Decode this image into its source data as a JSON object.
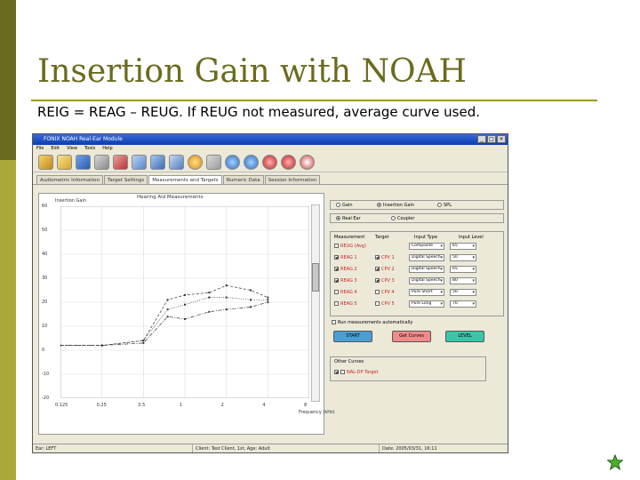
{
  "slide": {
    "title": "Insertion Gain with NOAH",
    "subtitle": "REIG = REAG – REUG. If REUG not measured, average curve used.",
    "accent": "#6b6b1e",
    "accent_light": "#a9a93a"
  },
  "app": {
    "window_title": "FONIX NOAH Real-Ear Module",
    "menu": [
      "File",
      "Edit",
      "View",
      "Tools",
      "Help"
    ],
    "toolbar_icons": [
      "new-icon",
      "open-icon",
      "save-icon",
      "print-icon",
      "settings-icon",
      "graph-icon",
      "measure-icon",
      "curve-icon",
      "target-icon",
      "list-icon",
      "noah-icon",
      "ssl-icon",
      "reference-icon",
      "help-icon"
    ],
    "tabs": [
      "Audiometric Information",
      "Target Settings",
      "Measurements and Targets",
      "Numeric Data",
      "Session Information"
    ],
    "active_tab": "Measurements and Targets",
    "graph": {
      "title": "Hearing Aid Measurements",
      "y_title": "Insertion Gain",
      "x_title": "Frequency (kHz)",
      "y_ticks": [
        "60",
        "50",
        "40",
        "30",
        "20",
        "10",
        "0",
        "-10",
        "-20"
      ],
      "x_ticks": [
        "0.125",
        "0.25",
        "0.5",
        "1",
        "2",
        "4",
        "8"
      ]
    },
    "display_mode": {
      "options": [
        "Gain",
        "Insertion Gain",
        "SPL"
      ],
      "selected": "Insertion Gain"
    },
    "ear_mode": {
      "options": [
        "Real Ear",
        "Coupler"
      ],
      "selected": "Real Ear"
    },
    "meas_headers": [
      "Measurement",
      "Target",
      "Input Type",
      "Input Level"
    ],
    "measurements": [
      {
        "meas": "REUG (Avg)",
        "meas_checked": false,
        "target": "",
        "target_checked": false,
        "input_type": "Composite",
        "input_level": "65",
        "color": "#cc2222"
      },
      {
        "meas": "REAG 1",
        "meas_checked": true,
        "target": "CPV 1",
        "target_checked": true,
        "input_type": "Digital Speech",
        "input_level": "50",
        "color": "#cc2222"
      },
      {
        "meas": "REAG 2",
        "meas_checked": true,
        "target": "CPV 2",
        "target_checked": true,
        "input_type": "Digital Speech",
        "input_level": "65",
        "color": "#cc2222"
      },
      {
        "meas": "REAG 3",
        "meas_checked": true,
        "target": "CPV 3",
        "target_checked": true,
        "input_type": "Digital Speech",
        "input_level": "80",
        "color": "#cc2222"
      },
      {
        "meas": "REAG 4",
        "meas_checked": false,
        "target": "CPV 4",
        "target_checked": false,
        "input_type": "Pure Short",
        "input_level": "50",
        "color": "#cc2222"
      },
      {
        "meas": "REAG 5",
        "meas_checked": false,
        "target": "CPV 5",
        "target_checked": false,
        "input_type": "Pure Long",
        "input_level": "70",
        "color": "#cc2222"
      }
    ],
    "run_auto_label": "Run measurements automatically",
    "buttons": {
      "start": "START",
      "get_curves": "Get Curves",
      "level": "LEVEL"
    },
    "other_curves": {
      "title": "Other Curves",
      "item": "NAL-DP Target"
    },
    "status": [
      "Ear: LEFT",
      "Client: Test Client, 1st, Age: Adult",
      "Date: 2005/03/31, 16:11"
    ]
  },
  "chart_data": {
    "type": "line",
    "title": "Hearing Aid Measurements",
    "xlabel": "Frequency (kHz)",
    "ylabel": "Insertion Gain",
    "x_scale": "log",
    "x_ticks": [
      0.125,
      0.25,
      0.5,
      1,
      2,
      4,
      8
    ],
    "ylim": [
      -20,
      60
    ],
    "grid": true,
    "series": [
      {
        "style": "dashed",
        "x": [
          0.125,
          0.25,
          0.5,
          0.75,
          1,
          1.5,
          2,
          3,
          4
        ],
        "values": [
          2,
          2,
          4,
          21,
          23,
          24,
          27,
          25,
          22
        ]
      },
      {
        "style": "dotted",
        "x": [
          0.125,
          0.25,
          0.5,
          0.75,
          1,
          1.5,
          2,
          3,
          4
        ],
        "values": [
          2,
          2,
          4,
          17,
          19,
          22,
          22,
          21,
          21
        ]
      },
      {
        "style": "dashdot",
        "x": [
          0.125,
          0.25,
          0.5,
          0.75,
          1,
          1.5,
          2,
          3,
          4
        ],
        "values": [
          2,
          2,
          3,
          14,
          13,
          16,
          17,
          18,
          20
        ]
      }
    ]
  }
}
